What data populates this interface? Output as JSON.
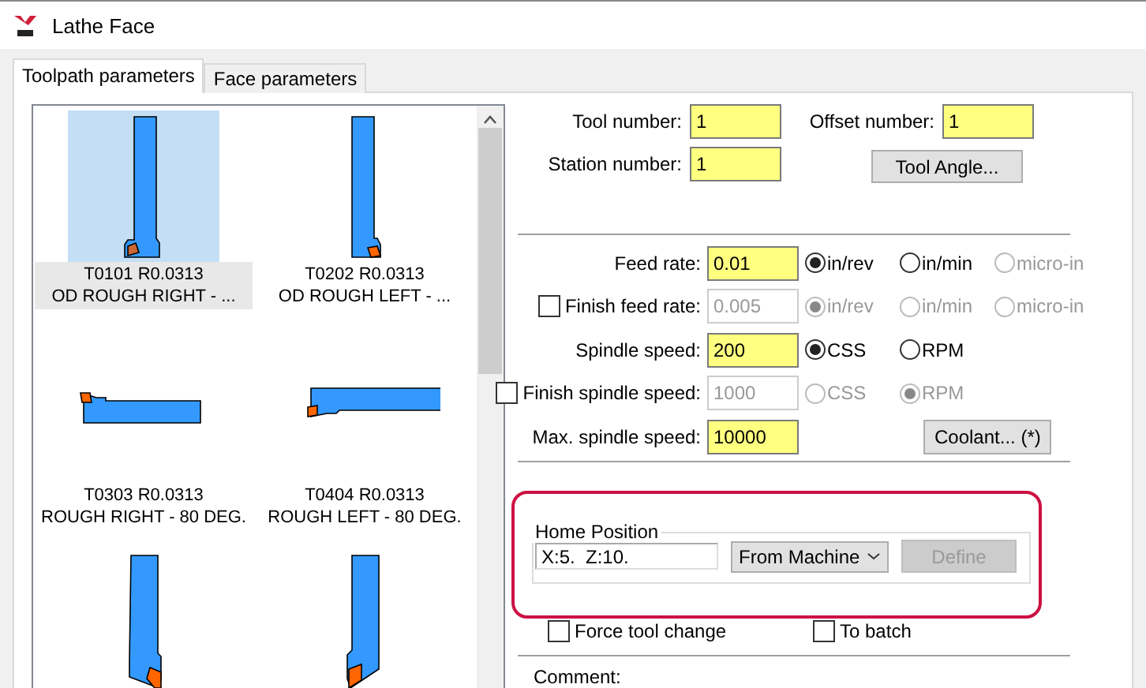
{
  "window": {
    "title": "Lathe Face"
  },
  "tabs": [
    {
      "label": "Toolpath parameters",
      "selected": true
    },
    {
      "label": "Face parameters",
      "selected": false
    }
  ],
  "tools": [
    {
      "kind": "vertical-right",
      "lines": [
        "T0101 R0.0313",
        "OD ROUGH RIGHT - ..."
      ],
      "selected": true
    },
    {
      "kind": "vertical-left",
      "lines": [
        "T0202 R0.0313",
        "OD ROUGH LEFT - ..."
      ],
      "selected": false
    },
    {
      "kind": "horizontal-right",
      "lines": [
        "T0303 R0.0313",
        "ROUGH RIGHT - 80 DEG."
      ],
      "selected": false
    },
    {
      "kind": "horizontal-left",
      "lines": [
        "T0404 R0.0313",
        "ROUGH LEFT - 80 DEG."
      ],
      "selected": false
    },
    {
      "kind": "angled-right",
      "selected": false
    },
    {
      "kind": "angled-left",
      "selected": false
    }
  ],
  "tool_fields": {
    "tool_number": {
      "label": "Tool number:",
      "value": "1"
    },
    "offset_number": {
      "label": "Offset number:",
      "value": "1"
    },
    "station_number": {
      "label": "Station number:",
      "value": "1"
    },
    "tool_angle_button": "Tool Angle..."
  },
  "feed_rows": [
    {
      "label": "Feed rate:",
      "value": "0.01",
      "disabled": false,
      "options": [
        {
          "label": "in/rev",
          "selected": true,
          "disabled": false
        },
        {
          "label": "in/min",
          "selected": false,
          "disabled": false
        },
        {
          "label": "micro-in",
          "selected": false,
          "disabled": true
        }
      ]
    },
    {
      "label": "Finish feed rate:",
      "value": "0.005",
      "disabled": true,
      "checked": false,
      "options": [
        {
          "label": "in/rev",
          "selected": true,
          "disabled": true
        },
        {
          "label": "in/min",
          "selected": false,
          "disabled": true
        },
        {
          "label": "micro-in",
          "selected": false,
          "disabled": true
        }
      ]
    },
    {
      "label": "Spindle speed:",
      "value": "200",
      "disabled": false,
      "options": [
        {
          "label": "CSS",
          "selected": true,
          "disabled": false
        },
        {
          "label": "RPM",
          "selected": false,
          "disabled": false
        }
      ]
    },
    {
      "label": "Finish spindle speed:",
      "value": "1000",
      "disabled": true,
      "checked": false,
      "options": [
        {
          "label": "CSS",
          "selected": false,
          "disabled": true
        },
        {
          "label": "RPM",
          "selected": true,
          "disabled": true
        }
      ]
    },
    {
      "label": "Max. spindle speed:",
      "value": "10000",
      "disabled": false,
      "button": "Coolant... (*)"
    }
  ],
  "home_position": {
    "title": "Home Position",
    "value": "X:5.  Z:10.",
    "dropdown": "From Machine",
    "define_button": "Define",
    "highlighted": true
  },
  "options": [
    {
      "label": "Force tool change",
      "checked": false
    },
    {
      "label": "To batch",
      "checked": false
    }
  ],
  "comment": {
    "label": "Comment:"
  }
}
